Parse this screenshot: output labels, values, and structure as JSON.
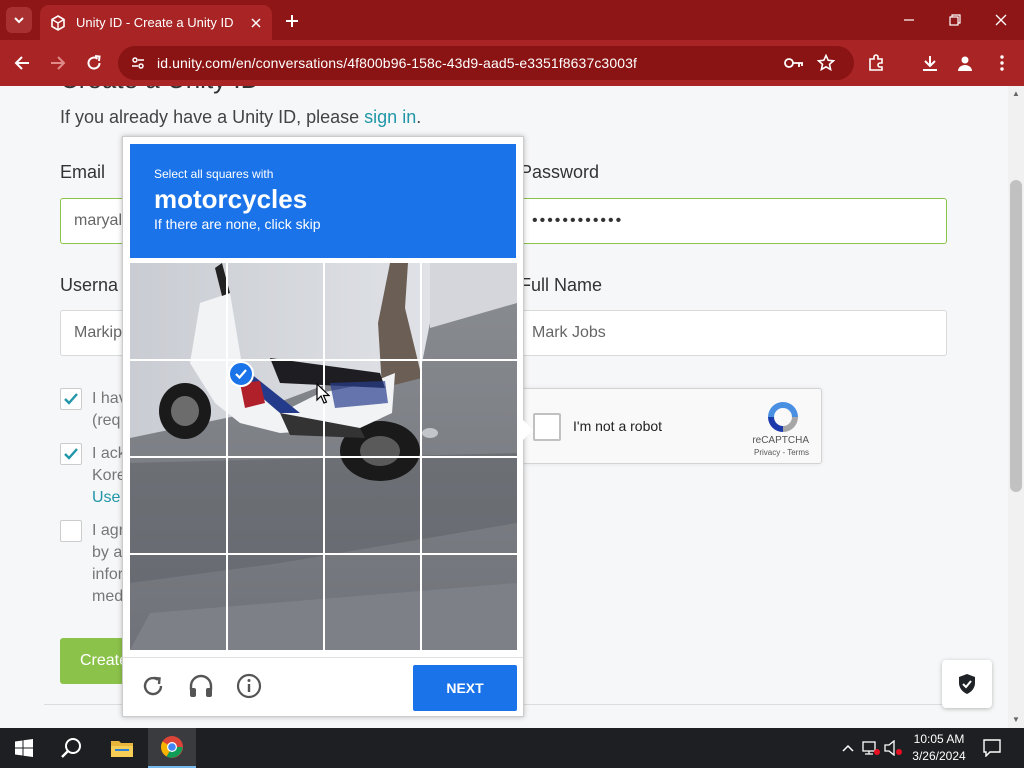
{
  "browser": {
    "tab_title": "Unity ID - Create a Unity ID",
    "url": "id.unity.com/en/conversations/4f800b96-158c-43d9-aad5-e3351f8637c3003f",
    "theme_color": "#a92424"
  },
  "page": {
    "heading": "Create a Unity ID",
    "signin_prefix": "If you already have a Unity ID, please ",
    "signin_link": "sign in",
    "signin_suffix": ".",
    "email_label": "Email",
    "email_value": "maryal",
    "password_label": "Password",
    "password_value": "••••••••••••",
    "username_label": "Userna",
    "username_value": "Markip",
    "fullname_label": "Full Name",
    "fullname_value": "Mark Jobs",
    "checkbox1_line1": "I hav",
    "checkbox1_line2": "(req",
    "checkbox2_line1": "I ack",
    "checkbox2_line2": "Kore",
    "checkbox2_line3": "Use",
    "checkbox3_line1": "I agr",
    "checkbox3_line2": "by a",
    "checkbox3_line3": "infor",
    "checkbox3_line4": "med",
    "create_button": "Create",
    "accent_color": "#8bc34a"
  },
  "recaptcha_anchor": {
    "label": "I'm not a robot",
    "brand": "reCAPTCHA",
    "links": "Privacy - Terms"
  },
  "challenge": {
    "instruction_line1": "Select all squares with",
    "target": "motorcycles",
    "instruction_line3": "If there are none, click skip",
    "next_label": "NEXT",
    "header_color": "#1a73e8",
    "grid_size": 4,
    "selected_tiles": [
      5
    ]
  },
  "taskbar": {
    "time": "10:05 AM",
    "date": "3/26/2024"
  }
}
